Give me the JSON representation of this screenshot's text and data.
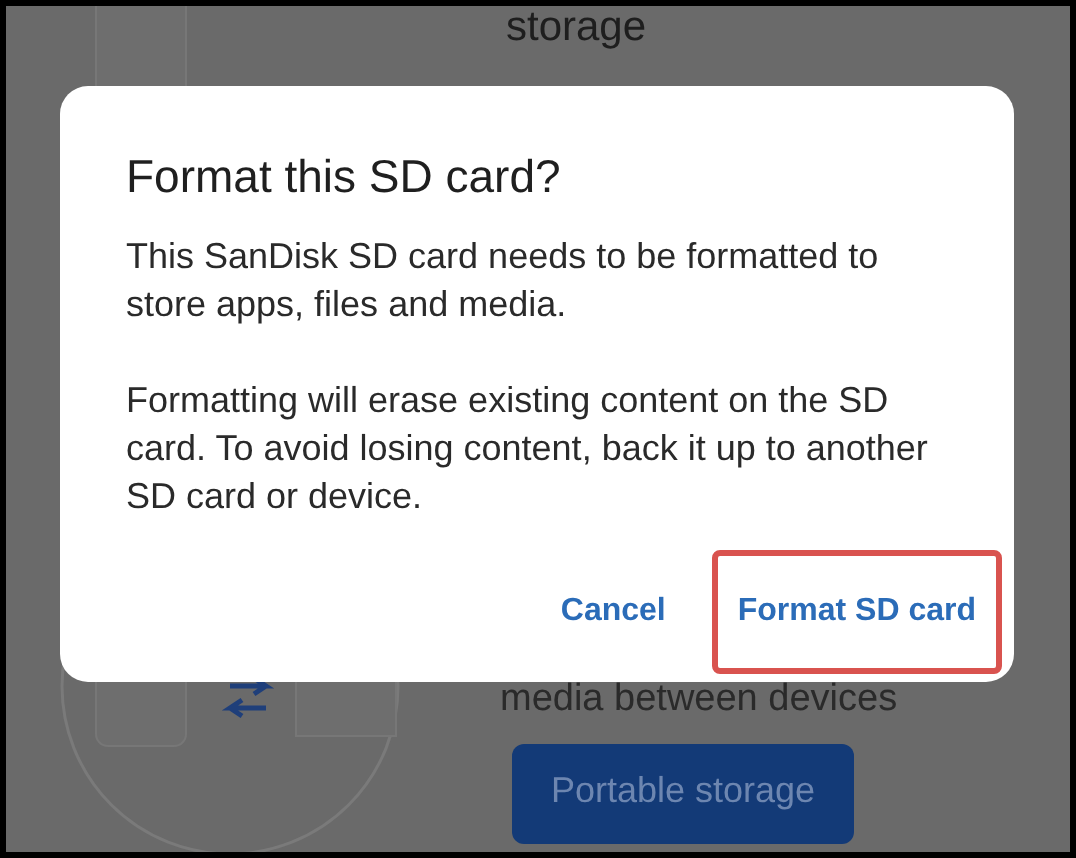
{
  "background": {
    "heading_fragment": "storage",
    "description_fragment": "media between devices",
    "button": "Portable storage"
  },
  "dialog": {
    "title": "Format this SD card?",
    "paragraphs": [
      "This SanDisk SD card needs to be formatted to store apps, files and media.",
      "Formatting will erase existing content on the SD card. To avoid losing content, back it up to another SD card or device."
    ],
    "buttons": [
      {
        "label": "Cancel",
        "highlighted": false
      },
      {
        "label": "Format SD card",
        "highlighted": true
      }
    ]
  }
}
